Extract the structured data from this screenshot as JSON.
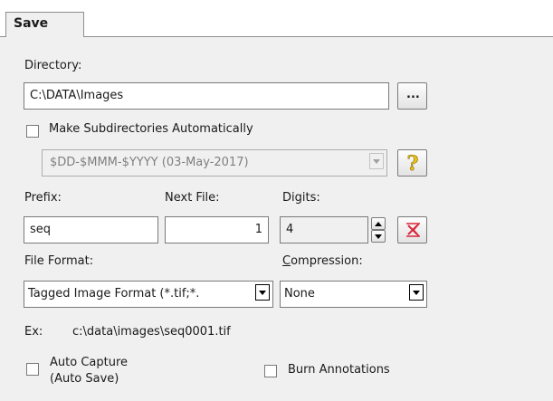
{
  "tab": {
    "label": "Save"
  },
  "directory": {
    "label": "Directory:",
    "value": "C:\\DATA\\Images",
    "browse_label": "..."
  },
  "subdirs": {
    "checkbox_label": "Make Subdirectories Automatically",
    "checked": false,
    "pattern_value": "$DD-$MMM-$YYYY (03-May-2017)",
    "help_label": "?"
  },
  "naming": {
    "prefix_label": "Prefix:",
    "prefix_value": "seq",
    "next_file_label": "Next File:",
    "next_file_value": "1",
    "digits_label": "Digits:",
    "digits_value": "4"
  },
  "format": {
    "file_format_label": "File Format:",
    "file_format_value": "Tagged Image Format (*.tif;*.",
    "compression_label_prefix": "",
    "compression_label_underline": "C",
    "compression_label_rest": "ompression:",
    "compression_value": "None"
  },
  "example": {
    "label": "Ex:",
    "value": "c:\\data\\images\\seq0001.tif"
  },
  "options": {
    "auto_capture_line1": "Auto Capture",
    "auto_capture_line2": "(Auto Save)",
    "auto_capture_checked": false,
    "burn_annotations_label": "Burn Annotations",
    "burn_annotations_checked": false
  },
  "colors": {
    "panel_bg": "#f0f0f0",
    "help_icon": "#e8c21a",
    "reset_icon": "#d9263a"
  }
}
